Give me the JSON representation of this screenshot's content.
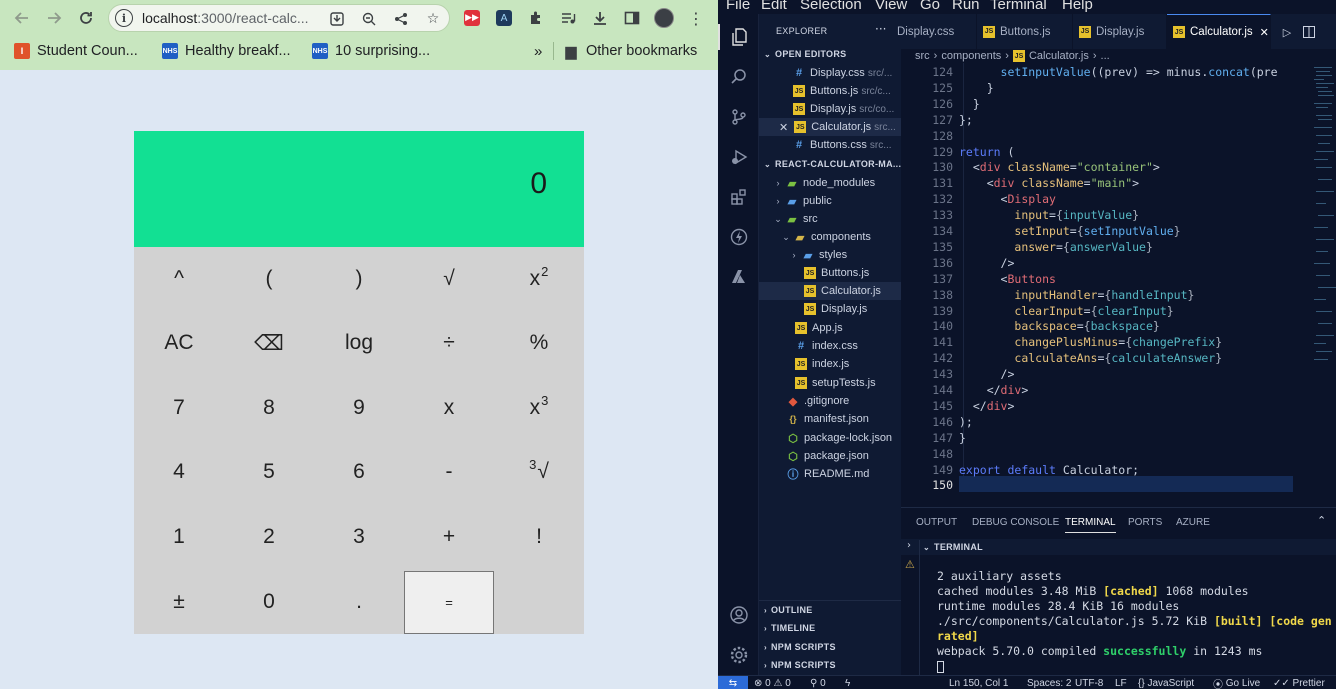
{
  "browser": {
    "url_host": "localhost",
    "url_path": ":3000/react-calc...",
    "bookmarks": [
      {
        "label": "Student Coun...",
        "icon": "illinois-icon"
      },
      {
        "label": "Healthy breakf...",
        "icon": "nhs-icon"
      },
      {
        "label": "10 surprising...",
        "icon": "nhs-icon"
      }
    ],
    "overflow": "»",
    "other_bookmarks": "Other bookmarks",
    "nhs_label": "NHS"
  },
  "calculator": {
    "display_value": "0",
    "rows": [
      [
        "^",
        "(",
        ")",
        "√",
        "x²"
      ],
      [
        "AC",
        "⌫",
        "log",
        "÷",
        "%"
      ],
      [
        "7",
        "8",
        "9",
        "x",
        "x³"
      ],
      [
        "4",
        "5",
        "6",
        "-",
        "∛"
      ],
      [
        "1",
        "2",
        "3",
        "+",
        "!"
      ],
      [
        "±",
        "0",
        ".",
        "="
      ]
    ]
  },
  "vscode": {
    "menu": [
      "File",
      "Edit",
      "Selection",
      "View",
      "Go",
      "Run",
      "Terminal",
      "Help"
    ],
    "explorer_title": "EXPLORER",
    "open_editors_title": "OPEN EDITORS",
    "open_editors": [
      {
        "name": "Display.css",
        "path": "src/...",
        "type": "css"
      },
      {
        "name": "Buttons.js",
        "path": "src/c...",
        "type": "js"
      },
      {
        "name": "Display.js",
        "path": "src/co...",
        "type": "js"
      },
      {
        "name": "Calculator.js",
        "path": "src...",
        "type": "js",
        "active": true
      },
      {
        "name": "Buttons.css",
        "path": "src...",
        "type": "css"
      }
    ],
    "project_title": "REACT-CALCULATOR-MA...",
    "tree": [
      {
        "name": "node_modules",
        "type": "nm",
        "depth": 1,
        "arrow": "›"
      },
      {
        "name": "public",
        "type": "folder",
        "depth": 1,
        "arrow": "›"
      },
      {
        "name": "src",
        "type": "folder",
        "depth": 1,
        "arrow": "⌄"
      },
      {
        "name": "components",
        "type": "folder",
        "depth": 2,
        "arrow": "⌄"
      },
      {
        "name": "styles",
        "type": "folder",
        "depth": 3,
        "arrow": "›"
      },
      {
        "name": "Buttons.js",
        "type": "js",
        "depth": 3
      },
      {
        "name": "Calculator.js",
        "type": "js",
        "depth": 3,
        "selected": true
      },
      {
        "name": "Display.js",
        "type": "js",
        "depth": 3
      },
      {
        "name": "App.js",
        "type": "js",
        "depth": 2
      },
      {
        "name": "index.css",
        "type": "css",
        "depth": 2
      },
      {
        "name": "index.js",
        "type": "js",
        "depth": 2
      },
      {
        "name": "setupTests.js",
        "type": "js",
        "depth": 2
      },
      {
        "name": ".gitignore",
        "type": "git",
        "depth": 1
      },
      {
        "name": "manifest.json",
        "type": "json",
        "depth": 1
      },
      {
        "name": "package-lock.json",
        "type": "lock",
        "depth": 1
      },
      {
        "name": "package.json",
        "type": "lock",
        "depth": 1
      },
      {
        "name": "README.md",
        "type": "info",
        "depth": 1
      }
    ],
    "outline_sections": [
      "OUTLINE",
      "TIMELINE",
      "NPM SCRIPTS",
      "NPM SCRIPTS"
    ],
    "tabs": [
      {
        "label": "Display.css",
        "type": "css"
      },
      {
        "label": "Buttons.js",
        "type": "js"
      },
      {
        "label": "Display.js",
        "type": "js"
      },
      {
        "label": "Calculator.js",
        "type": "js",
        "active": true
      }
    ],
    "breadcrumb": [
      "src",
      "components",
      "Calculator.js",
      "..."
    ],
    "code_lines": [
      {
        "n": "124",
        "text": "      setInputValue((prev) => minus.concat(pre"
      },
      {
        "n": "125",
        "text": "    }"
      },
      {
        "n": "126",
        "text": "  }"
      },
      {
        "n": "127",
        "text": "};"
      },
      {
        "n": "128",
        "text": ""
      },
      {
        "n": "129",
        "text": "return ("
      },
      {
        "n": "130",
        "text": "  <div className=\"container\">"
      },
      {
        "n": "131",
        "text": "    <div className=\"main\">"
      },
      {
        "n": "132",
        "text": "      <Display"
      },
      {
        "n": "133",
        "text": "        input={inputValue}"
      },
      {
        "n": "134",
        "text": "        setInput={setInputValue}"
      },
      {
        "n": "135",
        "text": "        answer={answerValue}"
      },
      {
        "n": "136",
        "text": "      />"
      },
      {
        "n": "137",
        "text": "      <Buttons"
      },
      {
        "n": "138",
        "text": "        inputHandler={handleInput}"
      },
      {
        "n": "139",
        "text": "        clearInput={clearInput}"
      },
      {
        "n": "140",
        "text": "        backspace={backspace}"
      },
      {
        "n": "141",
        "text": "        changePlusMinus={changePrefix}"
      },
      {
        "n": "142",
        "text": "        calculateAns={calculateAnswer}"
      },
      {
        "n": "143",
        "text": "      />"
      },
      {
        "n": "144",
        "text": "    </div>"
      },
      {
        "n": "145",
        "text": "  </div>"
      },
      {
        "n": "146",
        "text": ");"
      },
      {
        "n": "147",
        "text": "}"
      },
      {
        "n": "148",
        "text": ""
      },
      {
        "n": "149",
        "text": "export default Calculator;"
      },
      {
        "n": "150",
        "text": ""
      }
    ],
    "panel_tabs": [
      "OUTPUT",
      "DEBUG CONSOLE",
      "TERMINAL",
      "PORTS",
      "AZURE"
    ],
    "terminal_title": "TERMINAL",
    "terminal_lines": [
      "2 auxiliary assets",
      "cached modules 3.48 MiB [cached] 1068 modules",
      "runtime modules 28.4 KiB 16 modules",
      "./src/components/Calculator.js 5.72 KiB [built] [code gen",
      "rated]",
      "webpack 5.70.0 compiled successfully in 1243 ms"
    ],
    "status": {
      "errors": "0",
      "warnings": "0",
      "ports": "0",
      "position": "Ln 150, Col 1",
      "spaces": "Spaces: 2",
      "encoding": "UTF-8",
      "eol": "LF",
      "language": "JavaScript",
      "live": "Go Live",
      "prettier": "Prettier"
    }
  }
}
